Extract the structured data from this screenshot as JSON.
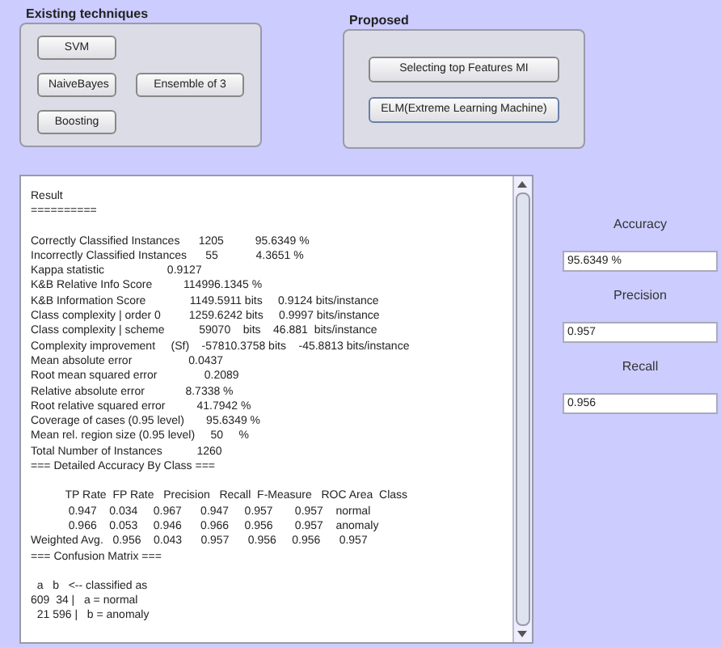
{
  "existing": {
    "title": "Existing techniques",
    "buttons": [
      "SVM",
      "NaiveBayes",
      "Ensemble of 3",
      "Boosting"
    ]
  },
  "proposed": {
    "title": "Proposed",
    "buttons": [
      "Selecting top Features MI",
      "ELM(Extreme Learning Machine)"
    ]
  },
  "result": {
    "sections": [
      {
        "lines": [
          "Result",
          "=========="
        ]
      },
      {
        "lines": [
          "Correctly Classified Instances      1205          95.6349 %",
          "Incorrectly Classified Instances      55            4.3651 %",
          "Kappa statistic                    0.9127",
          "K&B Relative Info Score          114996.1345 %",
          "K&B Information Score              1149.5911 bits     0.9124 bits/instance",
          "Class complexity | order 0         1259.6242 bits     0.9997 bits/instance",
          "Class complexity | scheme           59070    bits    46.881  bits/instance",
          "Complexity improvement     (Sf)    -57810.3758 bits    -45.8813 bits/instance",
          "Mean absolute error                  0.0437",
          "Root mean squared error               0.2089",
          "Relative absolute error             8.7338 %",
          "Root relative squared error          41.7942 %",
          "Coverage of cases (0.95 level)       95.6349 %",
          "Mean rel. region size (0.95 level)     50     %",
          "Total Number of Instances           1260",
          "=== Detailed Accuracy By Class ==="
        ]
      },
      {
        "lines": [
          "           TP Rate  FP Rate   Precision   Recall  F-Measure   ROC Area  Class",
          "            0.947    0.034     0.967      0.947     0.957       0.957    normal",
          "            0.966    0.053     0.946      0.966     0.956       0.957    anomaly",
          "Weighted Avg.   0.956    0.043      0.957      0.956     0.956      0.957",
          "=== Confusion Matrix ==="
        ]
      },
      {
        "lines": [
          "  a   b   <-- classified as",
          "609  34 |   a = normal",
          "  21 596 |   b = anomaly"
        ]
      }
    ]
  },
  "metrics": [
    {
      "label": "Accuracy",
      "value": "95.6349 %"
    },
    {
      "label": "Precision",
      "value": "0.957"
    },
    {
      "label": "Recall",
      "value": "0.956"
    }
  ]
}
